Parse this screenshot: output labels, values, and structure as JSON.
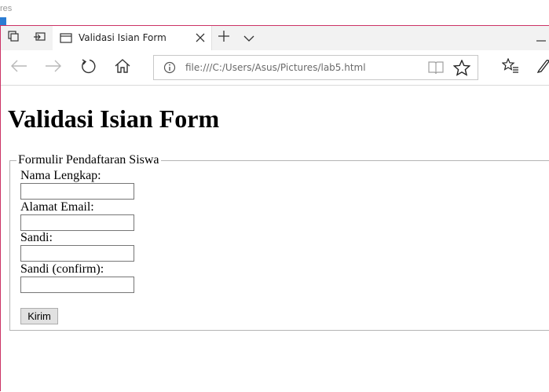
{
  "desktop": {
    "title_fragment": "res"
  },
  "browser": {
    "tab_title": "Validasi Isian Form",
    "address_url": "file:///C:/Users/Asus/Pictures/lab5.html",
    "icons": {
      "set_aside": "tabs-aside-icon",
      "tab_preview": "tab-preview-icon",
      "tab_page": "page-icon",
      "tab_close": "close-icon",
      "new_tab": "plus-icon",
      "tab_list": "chevron-down-icon",
      "back": "back-arrow-icon",
      "forward": "forward-arrow-icon",
      "refresh": "refresh-icon",
      "home": "home-icon",
      "info": "info-icon",
      "reading_view": "book-icon",
      "favorite": "star-icon",
      "favorites_hub": "favorites-list-icon",
      "notes": "pen-icon",
      "minimize": "minimize-icon"
    }
  },
  "page": {
    "heading": "Validasi Isian Form",
    "form": {
      "legend": "Formulir Pendaftaran Siswa",
      "fields": [
        {
          "label": "Nama Lengkap:",
          "value": ""
        },
        {
          "label": "Alamat Email:",
          "value": ""
        },
        {
          "label": "Sandi:",
          "value": ""
        },
        {
          "label": "Sandi (confirm):",
          "value": ""
        }
      ],
      "submit_label": "Kirim"
    }
  },
  "colors": {
    "window_frame": "#cc3366",
    "tabbar_bg": "#f2f2f2",
    "taskbar_accent": "#2b7cd3"
  }
}
